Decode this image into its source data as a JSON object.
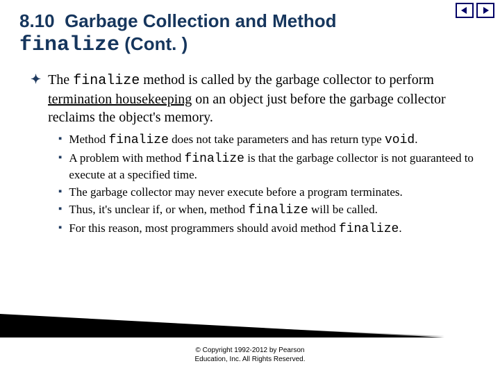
{
  "title": {
    "section_no": "8.10",
    "line1": "Garbage Collection and Method",
    "mono": "finalize",
    "suffix": "(Cont. )"
  },
  "main_bullet": {
    "pre": "The ",
    "mono": "finalize",
    "mid": " method is called by the garbage collector to perform ",
    "underline": "termination housekeeping",
    "post": " on an object just before the garbage collector reclaims the object's memory."
  },
  "sub_bullets": [
    {
      "pre": "Method ",
      "mono1": "finalize",
      "mid": " does not take parameters and has return type ",
      "mono2": "void",
      "post": "."
    },
    {
      "pre": "A problem with method ",
      "mono1": "finalize",
      "mid": " is that the garbage collector is not guaranteed to execute at a specified time.",
      "mono2": "",
      "post": ""
    },
    {
      "pre": "The garbage collector may never execute before a program terminates.",
      "mono1": "",
      "mid": "",
      "mono2": "",
      "post": ""
    },
    {
      "pre": "Thus, it's unclear if, or when, method ",
      "mono1": "finalize",
      "mid": " will be called.",
      "mono2": "",
      "post": ""
    },
    {
      "pre": "For this reason, most programmers should avoid method ",
      "mono1": "finalize",
      "mid": ".",
      "mono2": "",
      "post": ""
    }
  ],
  "copyright": {
    "line1": "© Copyright 1992-2012 by Pearson",
    "line2": "Education, Inc. All Rights Reserved."
  }
}
